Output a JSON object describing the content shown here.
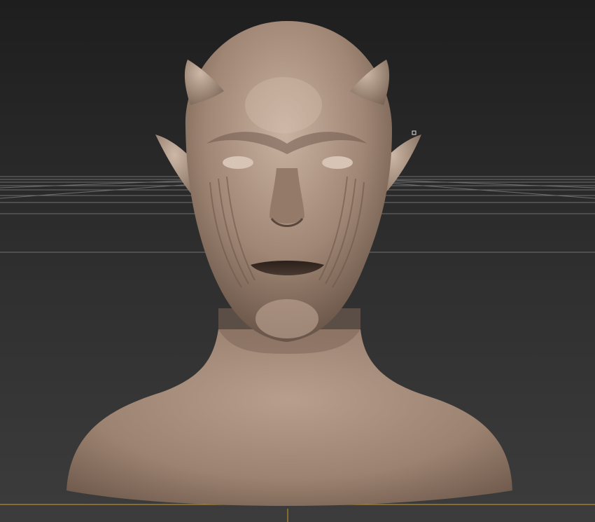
{
  "viewport": {
    "background_top": "#1f1f1f",
    "background_bottom": "#3b3b3b",
    "grid_color": "#8a8a8a",
    "axis_color": "#b58a2a",
    "subject": "sculpted-creature-bust",
    "skin_color": "#a88e7c",
    "skin_shadow": "#6b574a",
    "skin_highlight": "#d2bbaa"
  }
}
